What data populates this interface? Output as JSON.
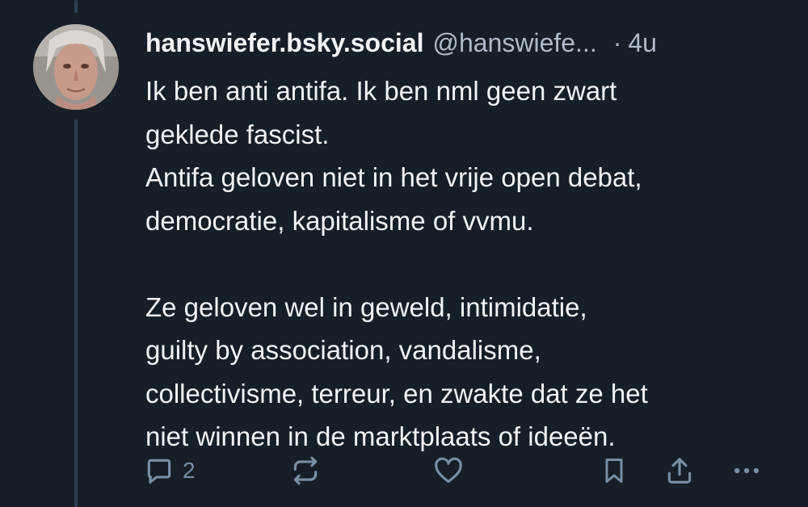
{
  "post": {
    "display_name": "hanswiefer.bsky.social",
    "handle": "@hanswiefe...",
    "separator": "·",
    "timestamp": "4u",
    "text_lines": [
      "Ik ben anti antifa. Ik ben nml geen zwart",
      "geklede fascist.",
      "Antifa geloven niet in het vrije open debat,",
      "democratie, kapitalisme of vvmu.",
      "Ze geloven wel in geweld, intimidatie,",
      "guilty by association, vandalisme,",
      "collectivisme, terreur, en zwakte dat ze het",
      "niet winnen in de marktplaats of ideeën."
    ]
  },
  "actions": {
    "reply_count": "2"
  },
  "colors": {
    "background": "#161e27",
    "text": "#f1f3f5",
    "muted": "#aebbc9",
    "icon": "#788ea5",
    "thread_line": "#2e4052"
  },
  "icons": [
    "reply-icon",
    "repost-icon",
    "like-icon",
    "bookmark-icon",
    "share-icon",
    "more-icon"
  ]
}
